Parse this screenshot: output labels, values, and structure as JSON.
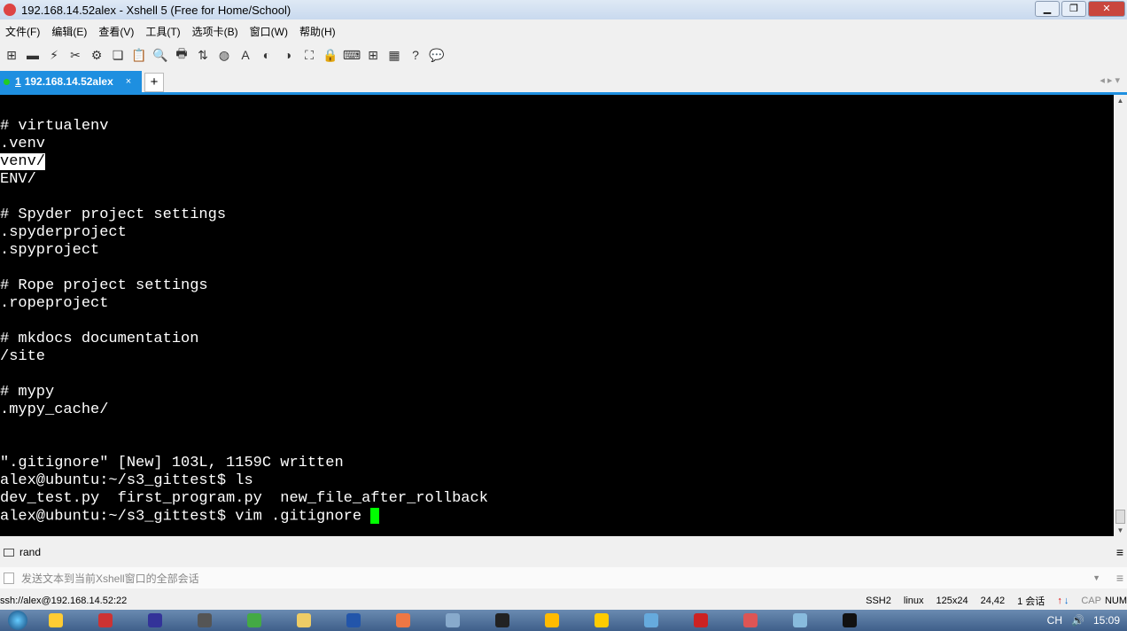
{
  "window": {
    "title": "192.168.14.52alex - Xshell 5 (Free for Home/School)",
    "minimize": "▁",
    "restore": "❐",
    "close": "✕"
  },
  "menu": [
    "文件(F)",
    "编辑(E)",
    "查看(V)",
    "工具(T)",
    "选项卡(B)",
    "窗口(W)",
    "帮助(H)"
  ],
  "toolbar": [
    {
      "icon": "new-session-icon",
      "g": "⊞"
    },
    {
      "icon": "open-folder-icon",
      "g": "▬"
    },
    {
      "icon": "connect-icon",
      "g": "⚡"
    },
    {
      "icon": "disconnect-icon",
      "g": "✂"
    },
    {
      "icon": "settings-icon",
      "g": "⚙"
    },
    {
      "icon": "copy-icon",
      "g": "❏"
    },
    {
      "icon": "paste-icon",
      "g": "📋"
    },
    {
      "icon": "find-icon",
      "g": "🔍"
    },
    {
      "icon": "print-icon",
      "g": "🖶"
    },
    {
      "icon": "transfer-icon",
      "g": "⇅"
    },
    {
      "icon": "globe-icon",
      "g": "◍"
    },
    {
      "icon": "font-icon",
      "g": "A"
    },
    {
      "icon": "xftp-icon",
      "g": "◐"
    },
    {
      "icon": "script-icon",
      "g": "◑"
    },
    {
      "icon": "fullscreen-icon",
      "g": "⛶"
    },
    {
      "icon": "lock-icon",
      "g": "🔒"
    },
    {
      "icon": "keyboard-icon",
      "g": "⌨"
    },
    {
      "icon": "add-layout-icon",
      "g": "⊞"
    },
    {
      "icon": "layout-icon",
      "g": "▦"
    },
    {
      "icon": "help-icon",
      "g": "?"
    },
    {
      "icon": "comment-icon",
      "g": "💬"
    }
  ],
  "tab": {
    "number": "1",
    "label": "192.168.14.52alex",
    "close": "×",
    "add": "+",
    "nav": "◂ ▸ ▾"
  },
  "terminal": {
    "lines": [
      "# virtualenv",
      ".venv",
      "venv/",
      "ENV/",
      "",
      "# Spyder project settings",
      ".spyderproject",
      ".spyproject",
      "",
      "# Rope project settings",
      ".ropeproject",
      "",
      "# mkdocs documentation",
      "/site",
      "",
      "# mypy",
      ".mypy_cache/",
      "",
      "",
      "\".gitignore\" [New] 103L, 1159C written",
      "alex@ubuntu:~/s3_gittest$ ls",
      "dev_test.py  first_program.py  new_file_after_rollback",
      "alex@ubuntu:~/s3_gittest$ vim .gitignore "
    ],
    "highlight_line": 2
  },
  "compose": {
    "text": "rand"
  },
  "sendbar": {
    "placeholder": "发送文本到当前Xshell窗口的全部会话"
  },
  "status": {
    "address": "ssh://alex@192.168.14.52:22",
    "protocol": "SSH2",
    "term": "linux",
    "size": "125x24",
    "pos": "24,42",
    "sessions": "1 会话",
    "cap": "CAP",
    "num": "NUM"
  },
  "tray": {
    "lang": "CH",
    "time": "15:09"
  }
}
